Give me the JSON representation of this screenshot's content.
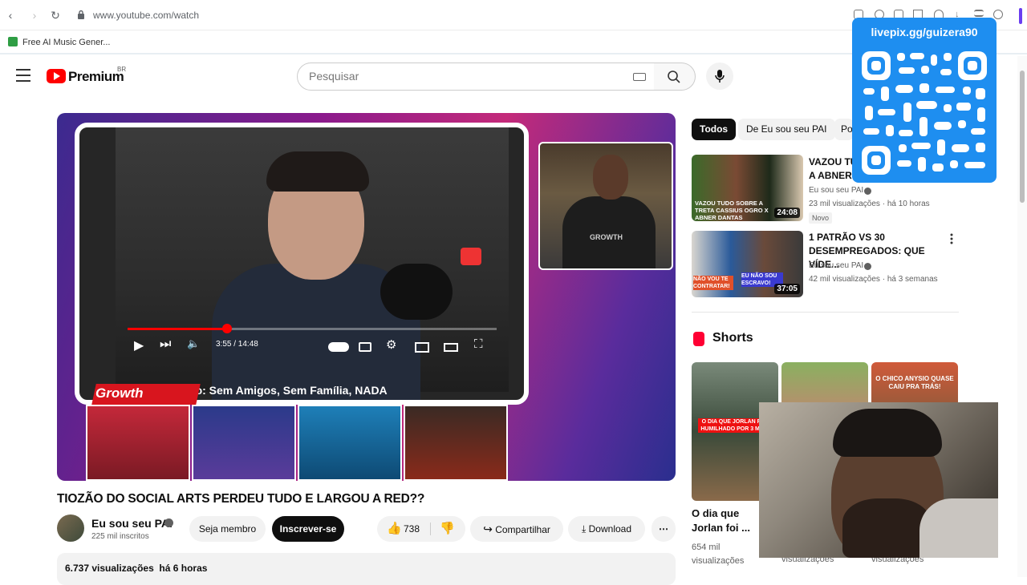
{
  "browser": {
    "url": "www.youtube.com/watch",
    "bookmark_label": "Free AI Music Gener..."
  },
  "header": {
    "brand": "Premium",
    "region": "BR",
    "search_placeholder": "Pesquisar"
  },
  "player": {
    "time": "3:55 / 14:48",
    "overlay_title": "Estou Velho: Sem Amigos, Sem Família, NADA",
    "sponsor_logo": "Growth",
    "reaction_shirt_text": "GROWTH",
    "progress_fraction": 0.27
  },
  "video": {
    "title": "TIOZÃO DO SOCIAL ARTS PERDEU TUDO E LARGOU A RED??",
    "channel": "Eu sou seu PAI",
    "subscribers": "225 mil inscritos",
    "member_label": "Seja membro",
    "subscribe_label": "Inscrever-se",
    "likes": "738",
    "share_label": "Compartilhar",
    "download_label": "Download",
    "views": "6.737 visualizações",
    "posted": "há 6 horas"
  },
  "sidebar": {
    "chips": [
      "Todos",
      "De Eu sou seu PAI",
      "Po"
    ],
    "recommendations": [
      {
        "title_line1": "VAZOU TU",
        "title_line2": "A ABNER D",
        "channel": "Eu sou seu PAI",
        "meta": "23 mil visualizações · há 10 horas",
        "badge": "Novo",
        "duration": "24:08",
        "thumb_text": "VAZOU TUDO SOBRE A TRETA CASSIUS OGRO X ABNER DANTAS"
      },
      {
        "title_line1": "1 PATRÃO VS 30",
        "title_line2": "DESEMPREGADOS: QUE VÍDE...",
        "channel": "Eu sou seu PAI",
        "meta": "42 mil visualizações · há 3 semanas",
        "duration": "37:05",
        "thumb_text_1": "NÃO VOU TE CONTRATAR!",
        "thumb_text_2": "EU NÃO SOU ESCRAVO!"
      }
    ],
    "shorts_label": "Shorts",
    "shorts": [
      {
        "title": "O dia que Jorlan foi ...",
        "views": "654 mil visualizações",
        "thumb_text": "O DIA QUE JORLAN FOI HUMILHADO POR 3 MEN"
      },
      {
        "title": "",
        "views": "visualizações"
      },
      {
        "title": "",
        "views": "visualizações",
        "thumb_text": "O CHICO ANYSIO QUASE CAIU PRA TRÁS!"
      }
    ]
  },
  "overlay": {
    "qr_label": "livepix.gg/guizera90"
  },
  "colors": {
    "brand_red": "#ff0000",
    "qr_blue": "#1e8ef0",
    "dark": "#0f0f0f"
  }
}
